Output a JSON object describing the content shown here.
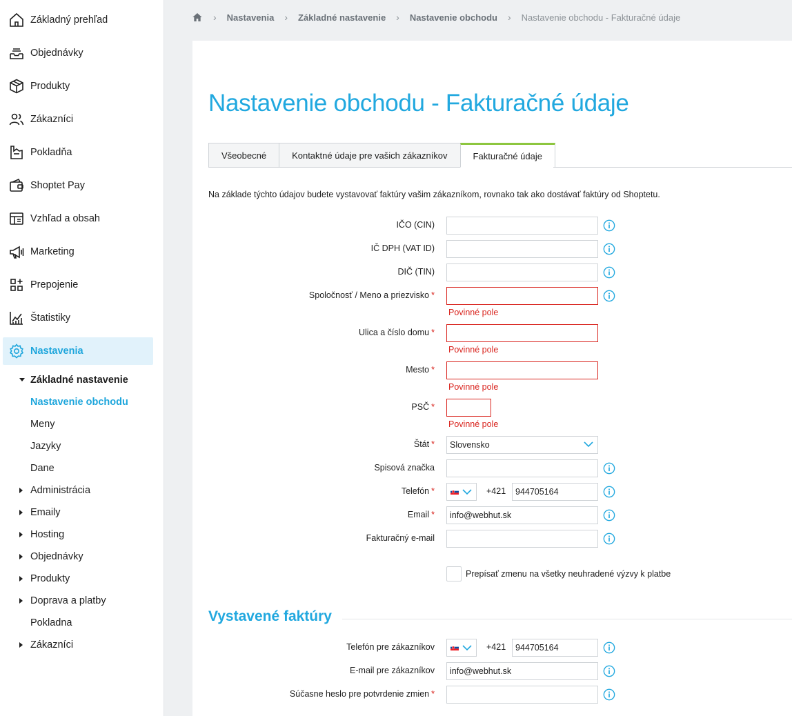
{
  "sidebar": {
    "items": [
      {
        "label": "Základný prehľad",
        "icon": "home-icon"
      },
      {
        "label": "Objednávky",
        "icon": "inbox-icon"
      },
      {
        "label": "Produkty",
        "icon": "box-icon"
      },
      {
        "label": "Zákazníci",
        "icon": "users-icon"
      },
      {
        "label": "Pokladňa",
        "icon": "register-icon"
      },
      {
        "label": "Shoptet Pay",
        "icon": "wallet-icon"
      },
      {
        "label": "Vzhľad a obsah",
        "icon": "layout-icon"
      },
      {
        "label": "Marketing",
        "icon": "megaphone-icon"
      },
      {
        "label": "Prepojenie",
        "icon": "apps-plus-icon"
      },
      {
        "label": "Štatistiky",
        "icon": "chart-icon"
      },
      {
        "label": "Nastavenia",
        "icon": "gear-icon"
      }
    ],
    "submenu": {
      "group_label": "Základné nastavenie",
      "current": "Nastavenie obchodu",
      "children": [
        "Meny",
        "Jazyky",
        "Dane"
      ],
      "collapsed": [
        "Administrácia",
        "Emaily",
        "Hosting",
        "Objednávky",
        "Produkty",
        "Doprava a platby"
      ],
      "pokladna": "Pokladna",
      "zakaznici": "Zákazníci"
    }
  },
  "breadcrumb": {
    "items": [
      "Nastavenia",
      "Základné nastavenie",
      "Nastavenie obchodu"
    ],
    "current": "Nastavenie obchodu - Fakturačné údaje"
  },
  "page": {
    "title": "Nastavenie obchodu - Fakturačné údaje",
    "tabs": [
      "Všeobecné",
      "Kontaktné údaje pre vašich zákazníkov",
      "Fakturačné údaje"
    ],
    "intro": "Na základe týchto údajov budete vystavovať faktúry vašim zákazníkom, rovnako tak ako dostávať faktúry od Shoptetu."
  },
  "form": {
    "ico": {
      "label": "IČO (CIN)",
      "value": ""
    },
    "icdph": {
      "label": "IČ DPH (VAT ID)",
      "value": ""
    },
    "dic": {
      "label": "DIČ (TIN)",
      "value": ""
    },
    "company": {
      "label": "Spoločnosť / Meno a priezvisko",
      "value": "",
      "error": "Povinné pole"
    },
    "street": {
      "label": "Ulica a číslo domu",
      "value": "",
      "error": "Povinné pole"
    },
    "city": {
      "label": "Mesto",
      "value": "",
      "error": "Povinné pole"
    },
    "zip": {
      "label": "PSČ",
      "value": "",
      "error": "Povinné pole"
    },
    "country": {
      "label": "Štát",
      "value": "Slovensko"
    },
    "registry": {
      "label": "Spisová značka",
      "value": ""
    },
    "phone": {
      "label": "Telefón",
      "prefix": "+421",
      "value": "944705164"
    },
    "email": {
      "label": "Email",
      "value": "info@webhut.sk"
    },
    "invoice_email": {
      "label": "Fakturačný e-mail",
      "value": ""
    },
    "overwrite_label": "Prepísať zmenu na všetky neuhradené výzvy k platbe",
    "required_mark": "*"
  },
  "issued": {
    "title": "Vystavené faktúry",
    "phone": {
      "label": "Telefón pre zákazníkov",
      "prefix": "+421",
      "value": "944705164"
    },
    "email": {
      "label": "E-mail pre zákazníkov",
      "value": "info@webhut.sk"
    },
    "password": {
      "label": "Súčasne heslo pre potvrdenie zmien",
      "value": ""
    }
  },
  "colors": {
    "accent": "#21a8df",
    "error": "#d9231d",
    "tab_active": "#8dc63f",
    "active_bg": "#e1f2fb"
  }
}
